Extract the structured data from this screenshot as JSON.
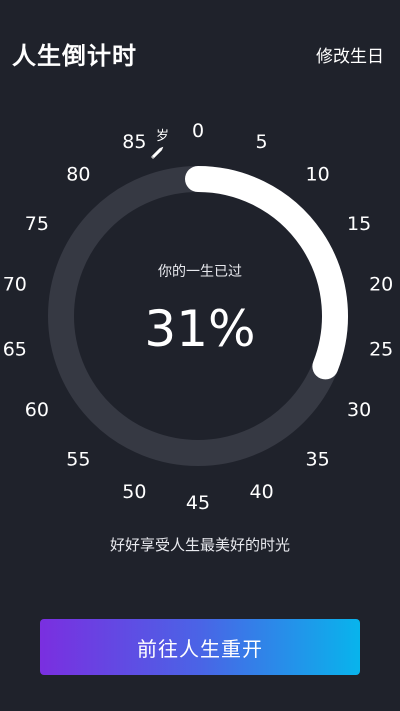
{
  "header": {
    "title": "人生倒计时",
    "edit_birthday_label": "修改生日"
  },
  "dial": {
    "age_unit": "岁",
    "ticks": [
      "0",
      "5",
      "10",
      "15",
      "20",
      "25",
      "30",
      "35",
      "40",
      "45",
      "50",
      "55",
      "60",
      "65",
      "70",
      "75",
      "80",
      "85"
    ],
    "progress_fraction": 0.31,
    "track_color": "#363943",
    "progress_color": "#ffffff",
    "pencil_icon": "pencil-icon"
  },
  "center": {
    "caption": "你的一生已过",
    "percent": "31%"
  },
  "motto": "好好享受人生最美好的时光",
  "cta": {
    "label": "前往人生重开",
    "gradient_start": "#7a2fe0",
    "gradient_end": "#08b4ec"
  }
}
